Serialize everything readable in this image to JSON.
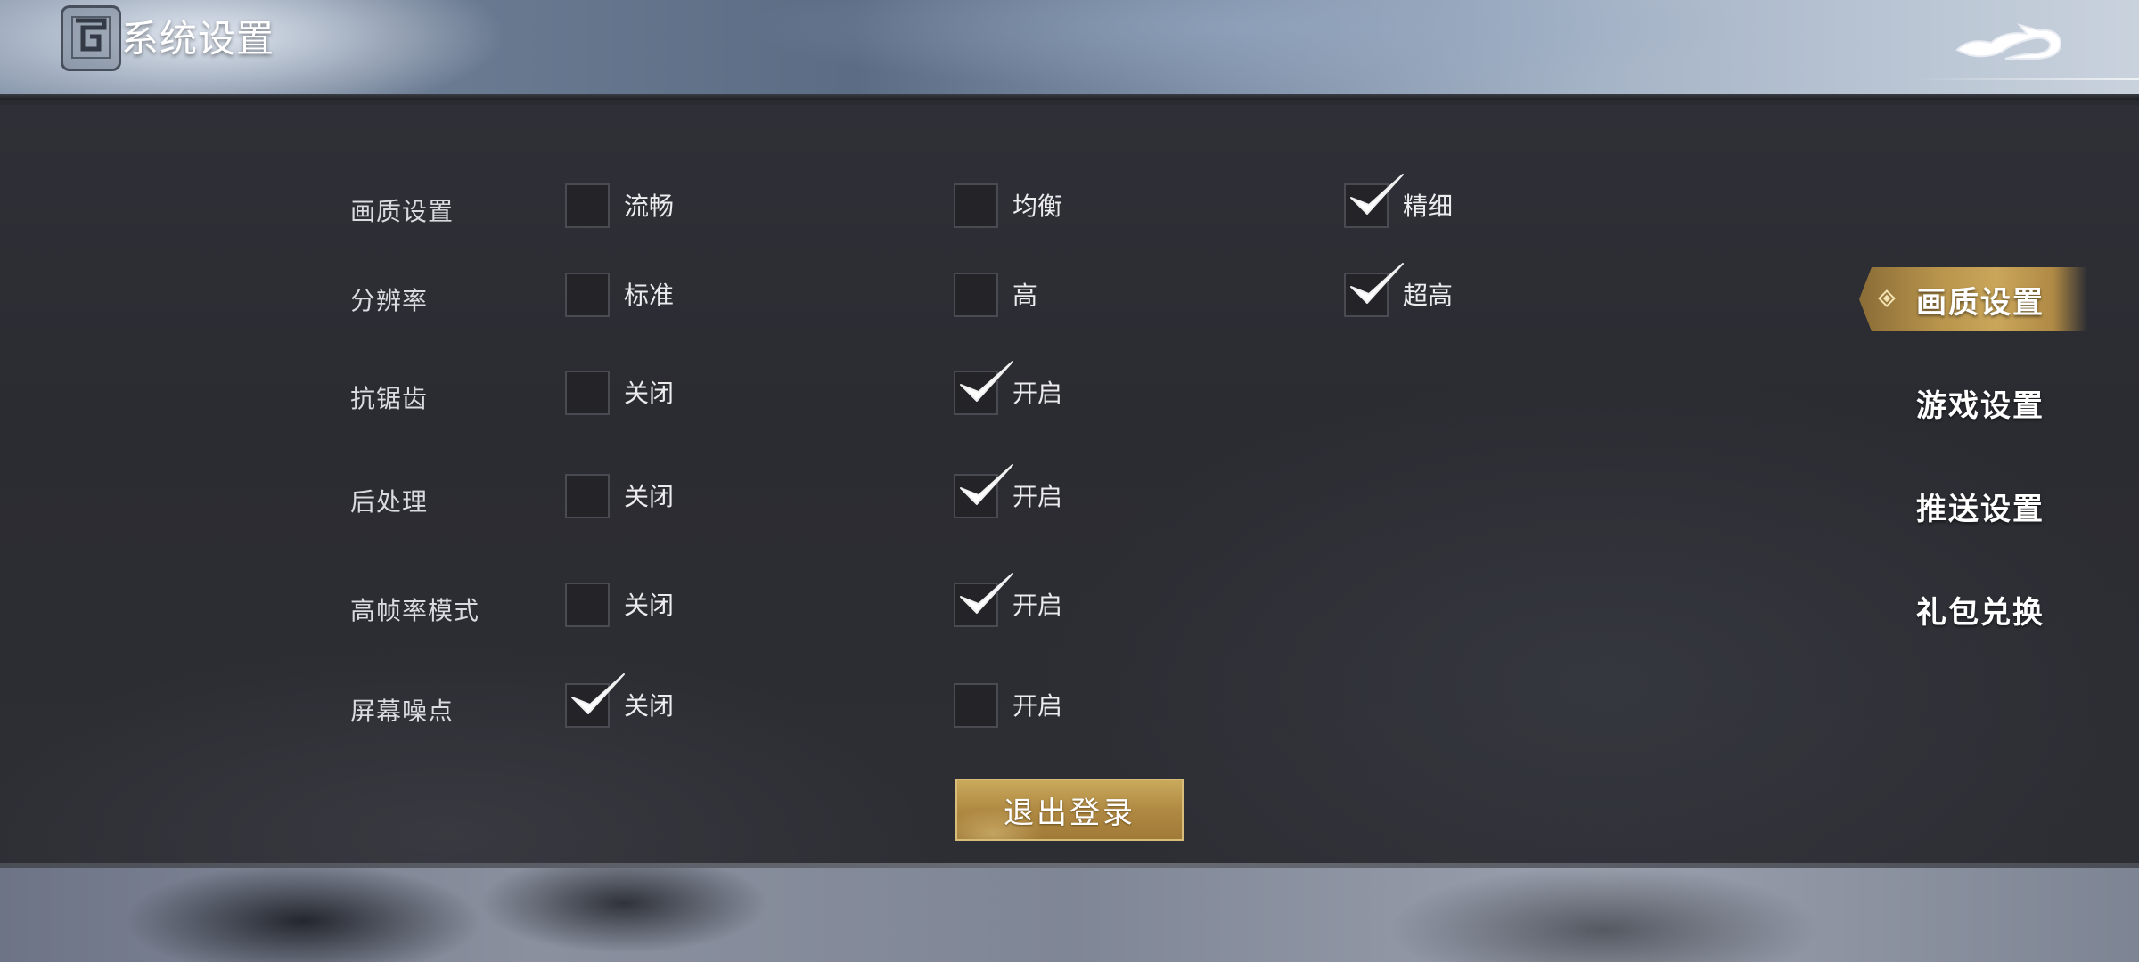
{
  "header": {
    "title": "系统设置",
    "logo_icon": "game-logo-icon",
    "back_icon": "dragon-back-icon"
  },
  "settings": [
    {
      "label": "画质设置",
      "options": [
        {
          "label": "流畅",
          "checked": false
        },
        {
          "label": "均衡",
          "checked": false
        },
        {
          "label": "精细",
          "checked": true
        }
      ]
    },
    {
      "label": "分辨率",
      "options": [
        {
          "label": "标准",
          "checked": false
        },
        {
          "label": "高",
          "checked": false
        },
        {
          "label": "超高",
          "checked": true
        }
      ]
    },
    {
      "label": "抗锯齿",
      "options": [
        {
          "label": "关闭",
          "checked": false
        },
        {
          "label": "开启",
          "checked": true
        }
      ]
    },
    {
      "label": "后处理",
      "options": [
        {
          "label": "关闭",
          "checked": false
        },
        {
          "label": "开启",
          "checked": true
        }
      ]
    },
    {
      "label": "高帧率模式",
      "options": [
        {
          "label": "关闭",
          "checked": false
        },
        {
          "label": "开启",
          "checked": true
        }
      ]
    },
    {
      "label": "屏幕噪点",
      "options": [
        {
          "label": "关闭",
          "checked": true
        },
        {
          "label": "开启",
          "checked": false
        }
      ]
    }
  ],
  "logout_label": "退出登录",
  "nav": {
    "active_index": 0,
    "items": [
      {
        "label": "画质设置"
      },
      {
        "label": "游戏设置"
      },
      {
        "label": "推送设置"
      },
      {
        "label": "礼包兑换"
      }
    ]
  },
  "colors": {
    "accent_gold": "#c9a95c",
    "check_white": "#ffffff"
  }
}
